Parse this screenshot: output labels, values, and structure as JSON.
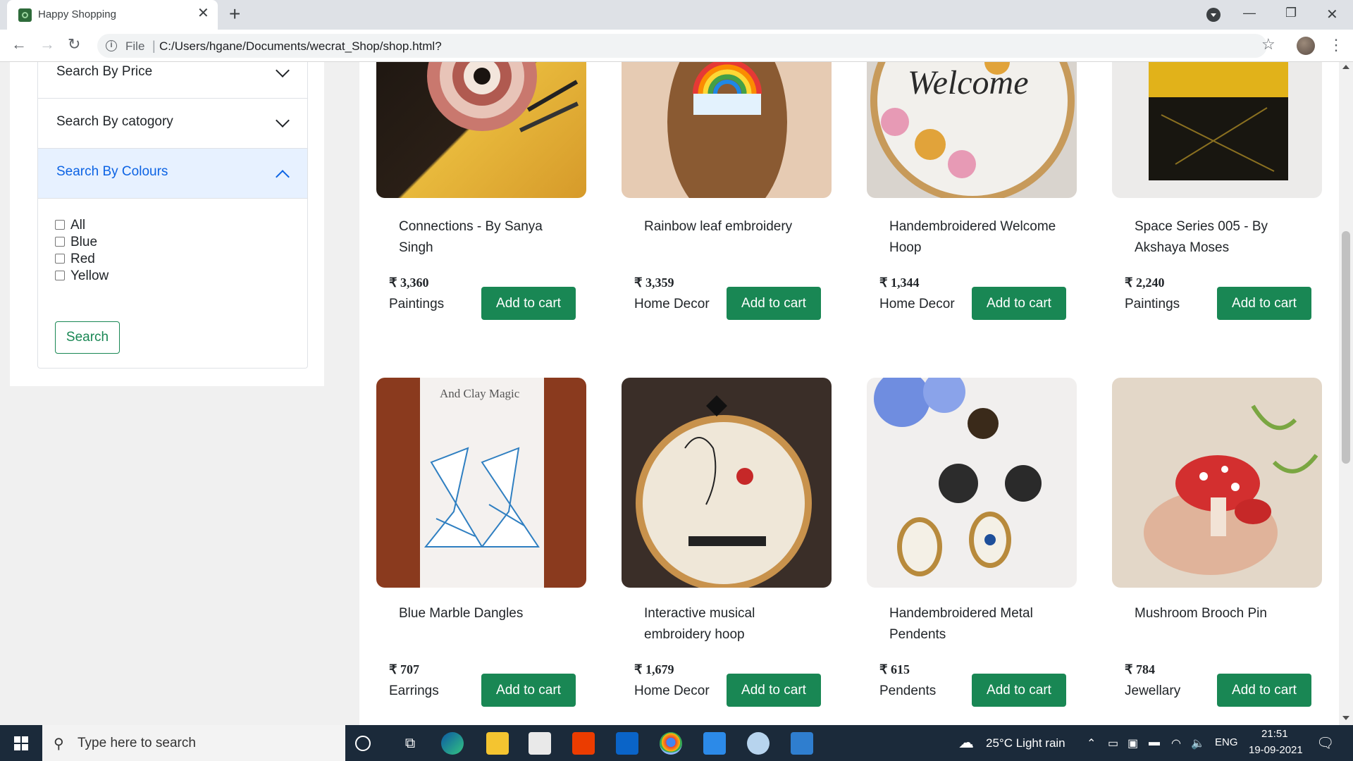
{
  "browser": {
    "tab_title": "Happy Shopping",
    "tab_close": "✕",
    "new_tab": "+",
    "url_scheme": "File",
    "url_sep": "|",
    "url": "C:/Users/hgane/Documents/wecrat_Shop/shop.html?"
  },
  "sidebar": {
    "filters": [
      {
        "label": "Search By Price",
        "expanded": false
      },
      {
        "label": "Search By catogory",
        "expanded": false
      },
      {
        "label": "Search By Colours",
        "expanded": true
      }
    ],
    "colour_options": [
      "All",
      "Blue",
      "Red",
      "Yellow"
    ],
    "search_button": "Search"
  },
  "products": [
    {
      "name": "Connections - By Sanya Singh",
      "price": "₹ 3,360",
      "category": "Paintings",
      "button": "Add to cart"
    },
    {
      "name": "Rainbow leaf embroidery",
      "price": "₹ 3,359",
      "category": "Home Decor",
      "button": "Add to cart"
    },
    {
      "name": "Handembroidered Welcome Hoop",
      "price": "₹ 1,344",
      "category": "Home Decor",
      "button": "Add to cart"
    },
    {
      "name": "Space Series 005 - By Akshaya Moses",
      "price": "₹ 2,240",
      "category": "Paintings",
      "button": "Add to cart"
    },
    {
      "name": "Blue Marble Dangles",
      "price": "₹ 707",
      "category": "Earrings",
      "button": "Add to cart"
    },
    {
      "name": "Interactive musical embroidery hoop",
      "price": "₹ 1,679",
      "category": "Home Decor",
      "button": "Add to cart"
    },
    {
      "name": "Handembroidered Metal Pendents",
      "price": "₹ 615",
      "category": "Pendents",
      "button": "Add to cart"
    },
    {
      "name": "Mushroom Brooch Pin",
      "price": "₹ 784",
      "category": "Jewellary",
      "button": "Add to cart"
    }
  ],
  "product_image_text": {
    "welcome": "Welcome",
    "clay_brand": "And Clay Magic"
  },
  "taskbar": {
    "search_placeholder": "Type here to search",
    "weather": "25°C  Light rain",
    "language": "ENG",
    "time": "21:51",
    "date": "19-09-2021"
  }
}
